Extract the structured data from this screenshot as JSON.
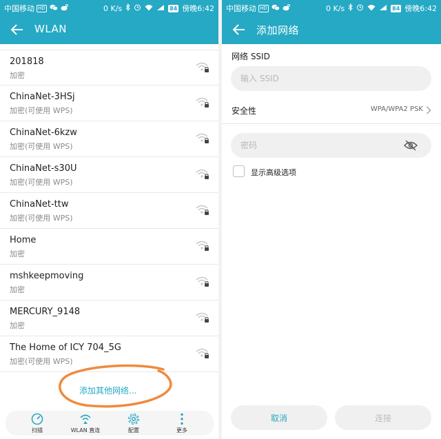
{
  "status": {
    "carrier": "中国移动",
    "hd_badge": "HD",
    "speed": "0 K/s",
    "battery": "84",
    "time": "傍晚6:42"
  },
  "left": {
    "title": "WLAN",
    "networks": [
      {
        "ssid": "201818",
        "security": "加密"
      },
      {
        "ssid": "ChinaNet-3HSj",
        "security": "加密(可使用 WPS)"
      },
      {
        "ssid": "ChinaNet-6kzw",
        "security": "加密(可使用 WPS)"
      },
      {
        "ssid": "ChinaNet-s30U",
        "security": "加密(可使用 WPS)"
      },
      {
        "ssid": "ChinaNet-ttw",
        "security": "加密(可使用 WPS)"
      },
      {
        "ssid": "Home",
        "security": "加密"
      },
      {
        "ssid": "mshkeepmoving",
        "security": "加密"
      },
      {
        "ssid": "MERCURY_9148",
        "security": "加密"
      },
      {
        "ssid": "The Home of ICY 704_5G",
        "security": "加密(可使用 WPS)"
      }
    ],
    "add_network": "添加其他网络...",
    "tabs": {
      "scan": "扫描",
      "direct": "WLAN 直连",
      "config": "配置",
      "more": "更多"
    }
  },
  "right": {
    "title": "添加网络",
    "ssid_label": "网络 SSID",
    "ssid_placeholder": "输入 SSID",
    "security_label": "安全性",
    "security_value": "WPA/WPA2 PSK",
    "password_placeholder": "密码",
    "advanced_label": "显示高级选项",
    "cancel": "取消",
    "connect": "连接"
  },
  "colors": {
    "accent": "#25a9c4",
    "annotation": "#f08a3c"
  },
  "icons": [
    "back-arrow-icon",
    "wifi-lock-icon",
    "scan-icon",
    "wifi-direct-icon",
    "gear-icon",
    "more-icon",
    "eye-off-icon",
    "chevron-right-icon"
  ]
}
